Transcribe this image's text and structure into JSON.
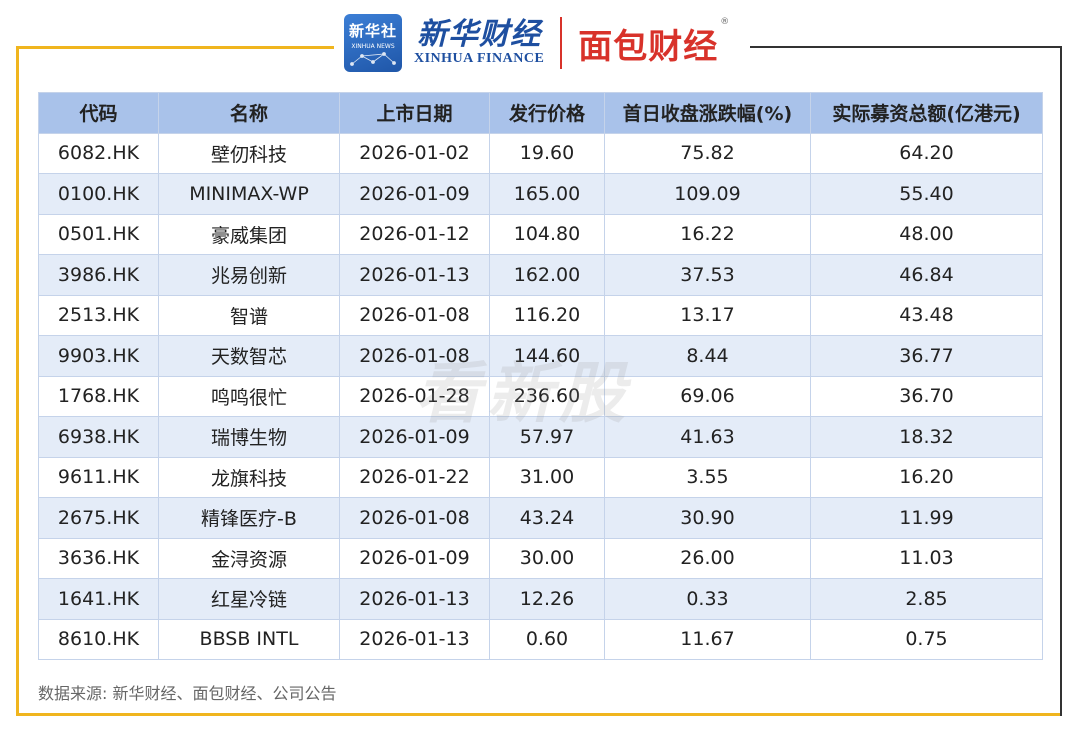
{
  "header": {
    "xinhua_badge_cn": "新华社",
    "xinhua_badge_en": "XINHUA NEWS",
    "xinhua_finance_cn": "新华财经",
    "xinhua_finance_en": "XINHUA FINANCE",
    "mianbao_logo": "面包财经",
    "mianbao_reg": "®"
  },
  "colors": {
    "frame_accent": "#f0b51e",
    "header_bg": "#a9c2ea",
    "row_alt_bg": "#e4ecf8",
    "xinhua_blue": "#1e4fa0",
    "mianbao_red": "#d8322a"
  },
  "table": {
    "columns": [
      "代码",
      "名称",
      "上市日期",
      "发行价格",
      "首日收盘涨跌幅(%)",
      "实际募资总额(亿港元)"
    ],
    "rows": [
      [
        "6082.HK",
        "壁仞科技",
        "2026-01-02",
        "19.60",
        "75.82",
        "64.20"
      ],
      [
        "0100.HK",
        "MINIMAX-WP",
        "2026-01-09",
        "165.00",
        "109.09",
        "55.40"
      ],
      [
        "0501.HK",
        "豪威集团",
        "2026-01-12",
        "104.80",
        "16.22",
        "48.00"
      ],
      [
        "3986.HK",
        "兆易创新",
        "2026-01-13",
        "162.00",
        "37.53",
        "46.84"
      ],
      [
        "2513.HK",
        "智谱",
        "2026-01-08",
        "116.20",
        "13.17",
        "43.48"
      ],
      [
        "9903.HK",
        "天数智芯",
        "2026-01-08",
        "144.60",
        "8.44",
        "36.77"
      ],
      [
        "1768.HK",
        "鸣鸣很忙",
        "2026-01-28",
        "236.60",
        "69.06",
        "36.70"
      ],
      [
        "6938.HK",
        "瑞博生物",
        "2026-01-09",
        "57.97",
        "41.63",
        "18.32"
      ],
      [
        "9611.HK",
        "龙旗科技",
        "2026-01-22",
        "31.00",
        "3.55",
        "16.20"
      ],
      [
        "2675.HK",
        "精锋医疗-B",
        "2026-01-08",
        "43.24",
        "30.90",
        "11.99"
      ],
      [
        "3636.HK",
        "金浔资源",
        "2026-01-09",
        "30.00",
        "26.00",
        "11.03"
      ],
      [
        "1641.HK",
        "红星冷链",
        "2026-01-13",
        "12.26",
        "0.33",
        "2.85"
      ],
      [
        "8610.HK",
        "BBSB INTL",
        "2026-01-13",
        "0.60",
        "11.67",
        "0.75"
      ]
    ]
  },
  "watermark": "看新股",
  "source": "数据来源: 新华财经、面包财经、公司公告"
}
